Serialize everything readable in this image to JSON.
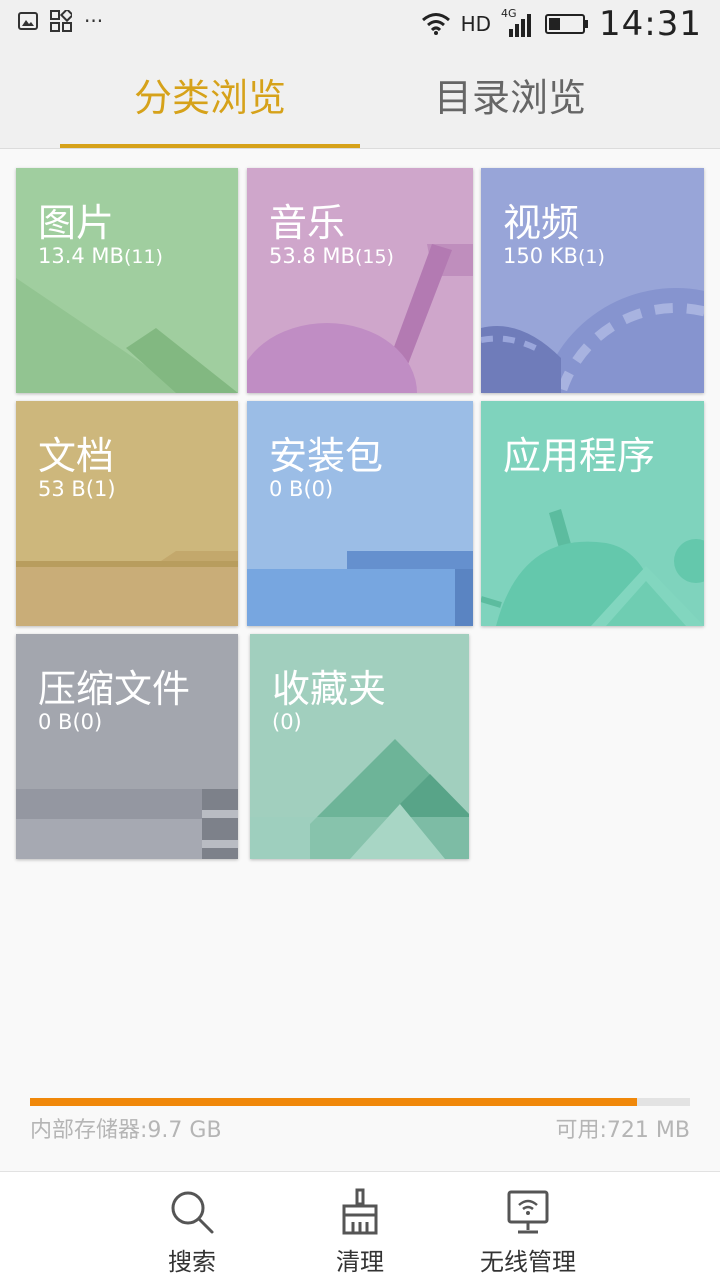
{
  "status_bar": {
    "time": "14:31",
    "network": "HD",
    "signal_label": "4G",
    "left_icons": [
      "image-icon",
      "qr-code-icon",
      "more-dots-icon"
    ],
    "more_dots": "···"
  },
  "tabs": [
    {
      "label": "分类浏览",
      "active": true
    },
    {
      "label": "目录浏览",
      "active": false
    }
  ],
  "categories": [
    {
      "title": "图片",
      "size": "13.4 MB",
      "count": "(11)",
      "color": "#a0ce9f"
    },
    {
      "title": "音乐",
      "size": "53.8 MB",
      "count": "(15)",
      "color": "#cfa6cb"
    },
    {
      "title": "视频",
      "size": "150 KB",
      "count": "(1)",
      "color": "#98a5d8"
    },
    {
      "title": "文档",
      "size": "53 B",
      "count": "(1)",
      "color": "#cdb77c"
    },
    {
      "title": "安装包",
      "size": "0 B",
      "count": "(0)",
      "color": "#9bbde6"
    },
    {
      "title": "应用程序",
      "size": "",
      "count": "",
      "color": "#7fd3bd"
    },
    {
      "title": "压缩文件",
      "size": "0 B",
      "count": "(0)",
      "color": "#a3a6ae"
    },
    {
      "title": "收藏夹",
      "size": "",
      "count": "(0)",
      "color": "#a1cfbe"
    }
  ],
  "storage": {
    "internal_label": "内部存储器:9.7 GB",
    "available_label": "可用:721 MB",
    "used_fraction": 0.92,
    "accent": "#f0880a"
  },
  "bottom_nav": [
    {
      "label": "搜索",
      "icon": "search-icon"
    },
    {
      "label": "清理",
      "icon": "broom-icon"
    },
    {
      "label": "无线管理",
      "icon": "wireless-monitor-icon"
    }
  ],
  "colors": {
    "accent": "#d6a21a",
    "tab_inactive": "#666666"
  }
}
